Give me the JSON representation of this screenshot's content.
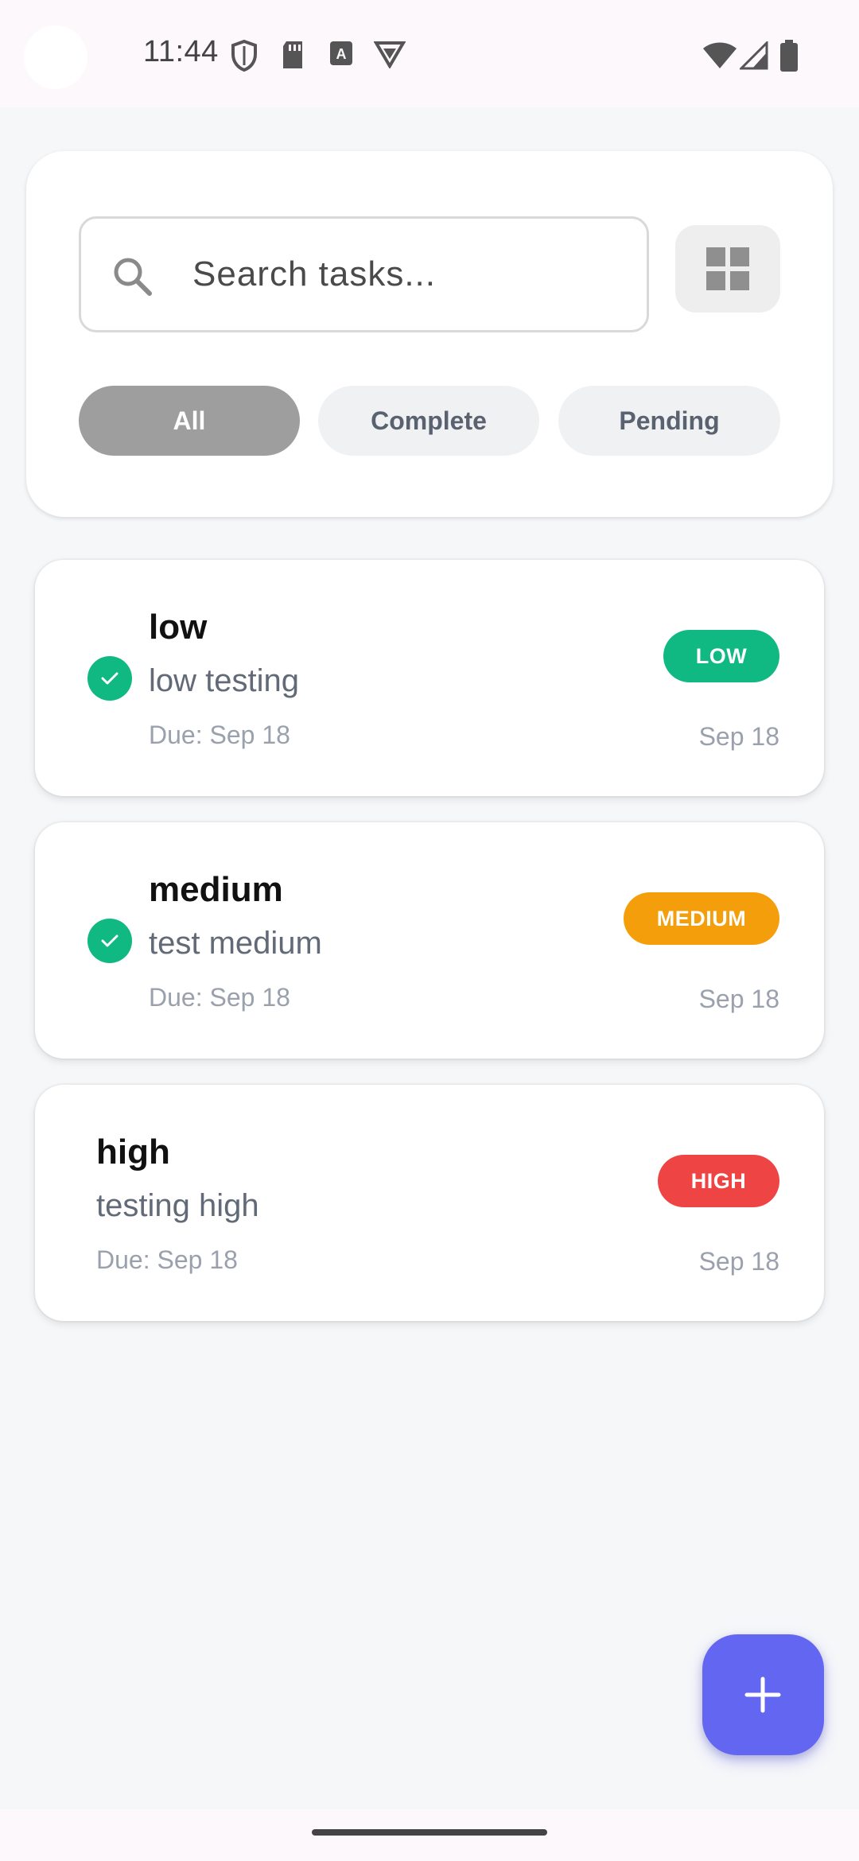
{
  "status_bar": {
    "time": "11:44",
    "icons": [
      "shield-icon",
      "sd-card-icon",
      "keyboard-a-icon",
      "vpn-icon",
      "wifi-icon",
      "signal-icon",
      "battery-icon"
    ]
  },
  "search": {
    "placeholder": "Search tasks...",
    "value": ""
  },
  "filters": [
    {
      "label": "All",
      "active": true
    },
    {
      "label": "Complete",
      "active": false
    },
    {
      "label": "Pending",
      "active": false
    }
  ],
  "tasks": [
    {
      "title": "low",
      "description": "low testing",
      "due": "Due: Sep 18",
      "date": "Sep 18",
      "priority": "LOW",
      "priority_color": "#10b981",
      "completed": true
    },
    {
      "title": "medium",
      "description": "test medium",
      "due": "Due: Sep 18",
      "date": "Sep 18",
      "priority": "MEDIUM",
      "priority_color": "#f59e0b",
      "completed": true
    },
    {
      "title": "high",
      "description": "testing high",
      "due": "Due: Sep 18",
      "date": "Sep 18",
      "priority": "HIGH",
      "priority_color": "#ef4444",
      "completed": false
    }
  ],
  "colors": {
    "accent": "#6366f1",
    "complete": "#10b981",
    "active_chip": "#9e9e9e"
  },
  "fab": {
    "icon": "plus-icon"
  }
}
